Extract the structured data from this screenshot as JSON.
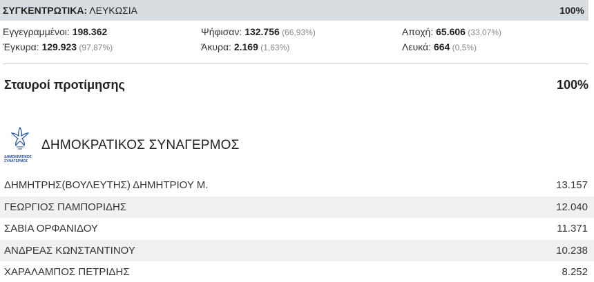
{
  "summary": {
    "label_bold": "ΣΥΓΚΕΝΤΡΩΤΙΚΑ:",
    "label_rest": " ΛΕΥΚΩΣΙΑ",
    "percent": "100%"
  },
  "stats": {
    "registered": {
      "label": "Εγγεγραμμένοι: ",
      "value": "198.362",
      "pct": ""
    },
    "voted": {
      "label": "Ψήφισαν: ",
      "value": "132.756",
      "pct": " (66,93%)"
    },
    "abstained": {
      "label": "Αποχή: ",
      "value": "65.606",
      "pct": " (33,07%)"
    },
    "valid": {
      "label": "Έγκυρα: ",
      "value": "129.923",
      "pct": " (97,87%)"
    },
    "invalid": {
      "label": "Άκυρα: ",
      "value": "2.169",
      "pct": " (1,63%)"
    },
    "blank": {
      "label": "Λευκά: ",
      "value": "664",
      "pct": " (0,5%)"
    }
  },
  "preferences": {
    "title": "Σταυροί προτίμησης",
    "percent": "100%"
  },
  "party": {
    "name": "ΔΗΜΟΚΡΑΤΙΚΟΣ ΣΥΝΑΓΕΡΜΟΣ",
    "logo_line1": "ΔΗΜΟΚΡΑΤΙΚΟΣ",
    "logo_line2": "ΣΥΝΑΓΕΡΜΟΣ",
    "logo_color": "#1c4fa0"
  },
  "candidates": [
    {
      "name": "ΔΗΜΗΤΡΗΣ(ΒΟΥΛΕΥΤΗΣ) ΔΗΜΗΤΡΙΟΥ Μ.",
      "votes": "13.157"
    },
    {
      "name": "ΓΕΩΡΓΙΟΣ ΠΑΜΠΟΡΙΔΗΣ",
      "votes": "12.040"
    },
    {
      "name": "ΣΑΒΙΑ ΟΡΦΑΝΙΔΟΥ",
      "votes": "11.371"
    },
    {
      "name": "ΑΝΔΡΕΑΣ ΚΩΝΣΤΑΝΤΙΝΟΥ",
      "votes": "10.238"
    },
    {
      "name": "ΧΑΡΑΛΑΜΠΟΣ ΠΕΤΡΙΔΗΣ",
      "votes": "8.252"
    }
  ]
}
